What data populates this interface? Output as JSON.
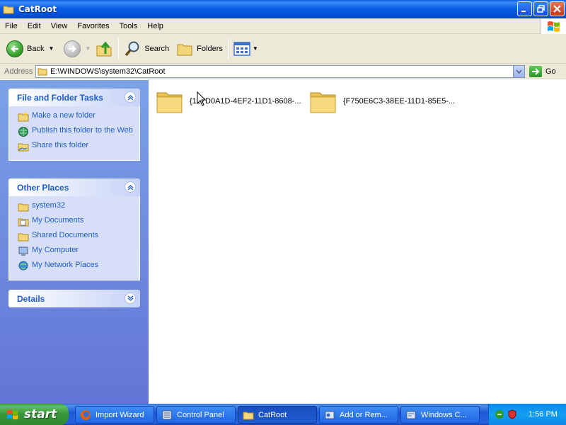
{
  "window": {
    "title": "CatRoot"
  },
  "menu": {
    "items": [
      "File",
      "Edit",
      "View",
      "Favorites",
      "Tools",
      "Help"
    ]
  },
  "toolbar": {
    "back": "Back",
    "search": "Search",
    "folders": "Folders"
  },
  "address": {
    "label": "Address",
    "value": "E:\\WINDOWS\\system32\\CatRoot",
    "go": "Go"
  },
  "left_pane": {
    "tasks": {
      "title": "File and Folder Tasks",
      "items": [
        {
          "label": "Make a new folder",
          "icon": "new-folder-icon"
        },
        {
          "label": "Publish this folder to the Web",
          "icon": "publish-web-icon"
        },
        {
          "label": "Share this folder",
          "icon": "share-folder-icon"
        }
      ]
    },
    "other_places": {
      "title": "Other Places",
      "items": [
        {
          "label": "system32",
          "icon": "folder-icon"
        },
        {
          "label": "My Documents",
          "icon": "my-documents-icon"
        },
        {
          "label": "Shared Documents",
          "icon": "folder-icon"
        },
        {
          "label": "My Computer",
          "icon": "my-computer-icon"
        },
        {
          "label": "My Network Places",
          "icon": "network-places-icon"
        }
      ]
    },
    "details": {
      "title": "Details"
    }
  },
  "files": [
    {
      "name": "{127D0A1D-4EF2-11D1-8608-..."
    },
    {
      "name": "{F750E6C3-38EE-11D1-85E5-..."
    }
  ],
  "taskbar": {
    "start": "start",
    "buttons": [
      {
        "label": "Import Wizard",
        "icon": "firefox-icon"
      },
      {
        "label": "Control Panel",
        "icon": "control-panel-icon"
      },
      {
        "label": "CatRoot",
        "icon": "folder-icon"
      },
      {
        "label": "Add or Rem...",
        "icon": "add-remove-icon"
      },
      {
        "label": "Windows C...",
        "icon": "windows-icon"
      }
    ],
    "clock": "1:56 PM"
  },
  "colors": {
    "titlebar": "#0a5ee6",
    "taskpane_link": "#215dc6",
    "start_green": "#38953a"
  }
}
